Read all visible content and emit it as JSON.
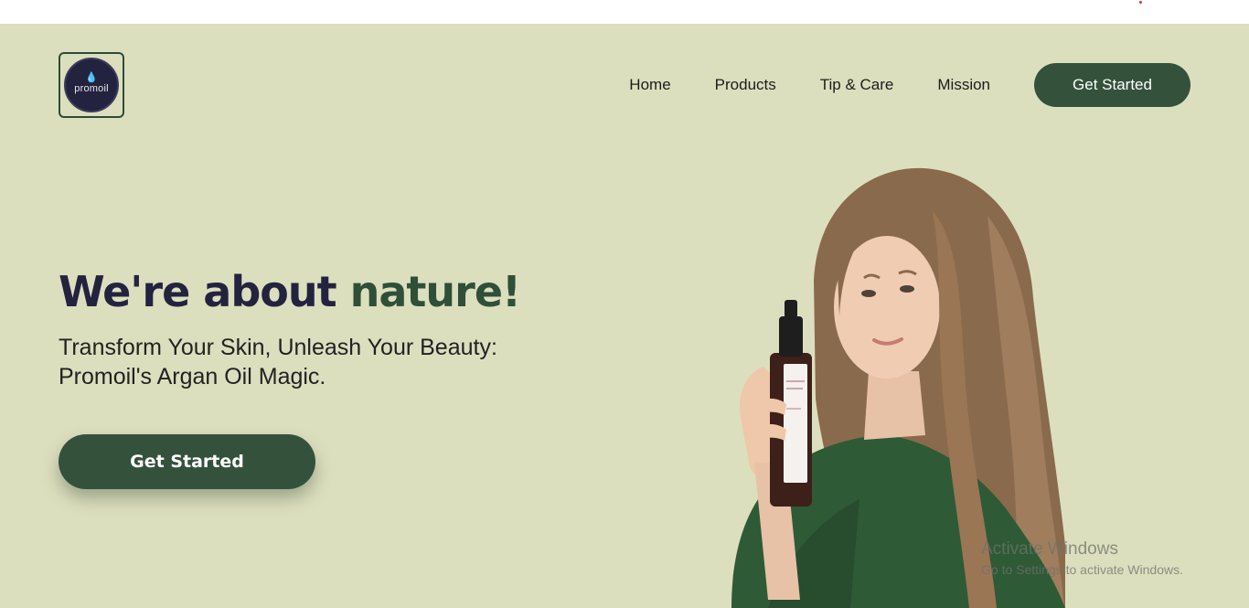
{
  "brand": {
    "logo_text": "promoil"
  },
  "nav": {
    "links": [
      "Home",
      "Products",
      "Tip & Care",
      "Mission"
    ],
    "cta_label": "Get Started"
  },
  "hero": {
    "headline_main": "We're about ",
    "headline_accent": "nature!",
    "subtitle_line1": "Transform Your Skin, Unleash Your Beauty:",
    "subtitle_line2": "Promoil's Argan Oil Magic.",
    "cta_label": "Get Started"
  },
  "watermark": {
    "title": "Activate Windows",
    "subtitle": "Go to Settings to activate Windows."
  },
  "colors": {
    "background": "#dcdfbe",
    "primary_green": "#34513c",
    "navy": "#23233f"
  }
}
